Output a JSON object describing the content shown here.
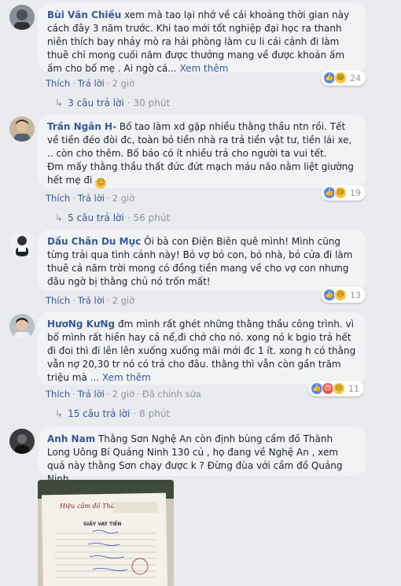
{
  "comments": [
    {
      "author": "Bùi Văn Chiều",
      "text": "xem mà tao lại nhớ về cái khoảng thời gian này cách đây 3 năm trước. Khi tao mới tốt nghiệp đại học ra thanh niên thích bay nhảy mò ra hải phòng làm cu li cái cảnh đi làm thuê chỉ mong cuối năm được thưởng mang về được khoản ấm ấm cho bố mẹ . Ai ngờ cá...",
      "see_more": "Xem thêm",
      "like": "Thích",
      "reply": "Trả lời",
      "time": "2 giờ",
      "reaction_count": "24",
      "reply_count": "3 câu trả lời",
      "reply_time": "30 phút"
    },
    {
      "author": "Trần Ngân H-",
      "text_line1": "Bố tao làm xd gặp nhiều thằng thầu ntn rồi. Tết về tiền đéo đòi đc, toàn bỏ tiền nhà ra trả tiền vật tư, tiền lái xe, .. còn cho thêm. Bố bảo có ít nhiều trả cho người ta vui tết.",
      "text_line2": "Đm mấy thằng thầu thất đức đứt mạch máu não nằm liệt giường hết mẹ đi",
      "like": "Thích",
      "reply": "Trả lời",
      "time": "2 giờ",
      "reaction_count": "19",
      "reply_count": "5 câu trả lời",
      "reply_time": "56 phút"
    },
    {
      "author": "Dấu Chân Du Mục",
      "text": "Ôi bà con Điện Biên quê mình! Mình cũng từng trải qua tình cảnh này! Bỏ vợ bỏ con, bỏ nhà, bỏ cửa đi làm thuê cả năm trời mong có đồng tiền mang về cho vợ con nhưng đâu ngờ bị thằng chủ nó trốn mất!",
      "like": "Thích",
      "reply": "Trả lời",
      "time": "2 giờ",
      "reaction_count": "13"
    },
    {
      "author": "HươNg KưNg",
      "text": "đm mình rất ghét những thằng thầu công trình. vì bố mình rất hiền hay cả nể,đi chở cho nó. xong nó k bgio trả hết đi đoi thì đi lên lên xuống xuống mãi mới đc 1 ít. xong h có thằng vẫn nợ 20,30 tr nó có trả cho đâu. thằng thì vẫn còn gần trăm triệu mà",
      "see_more": "... Xem thêm",
      "like": "Thích",
      "reply": "Trả lời",
      "time": "2 giờ",
      "edited": "Đã chỉnh sửa",
      "reaction_count": "11",
      "reply_count": "15 câu trả lời",
      "reply_time": "8 phút"
    },
    {
      "author": "Anh Nam",
      "text": "Thằng Sơn Nghệ An còn định bùng cầm đồ Thành Long Uông Bí Quảng Ninh 130 củ , họ đang về Nghệ An , xem quả này thằng Sơn chạy được k ? Đừng đùa với cầm đồ Quảng Ninh",
      "photo_title": "Hiệu cầm đồ Thành Long",
      "photo_heading": "GIẤY VAY TIỀN"
    }
  ],
  "colors": {
    "background": "#e9ebee",
    "bubble": "#f2f3f5",
    "link": "#385898",
    "muted": "#90949c"
  }
}
